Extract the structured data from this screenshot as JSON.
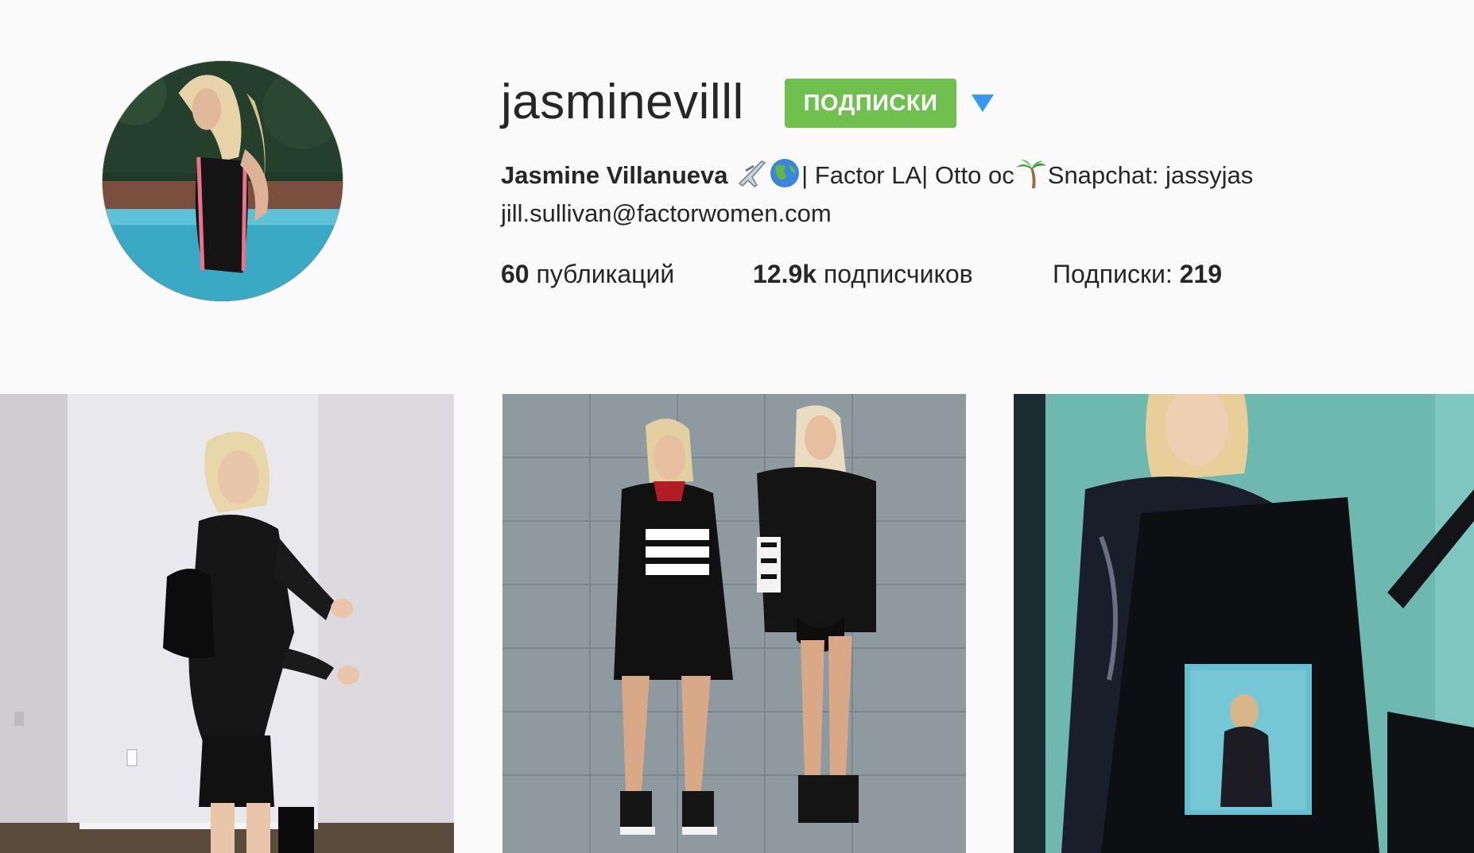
{
  "profile": {
    "username": "jasminevilll",
    "follow_button_label": "ПОДПИСКИ",
    "full_name": "Jasmine Villanueva",
    "bio_segment_1": "| Factor LA| Otto oc",
    "bio_segment_2": "Snapchat: jassyjas",
    "link": "jill.sullivan@factorwomen.com"
  },
  "stats": {
    "posts_count": "60",
    "posts_label": " публикаций",
    "followers_count": "12.9k",
    "followers_label": " подписчиков",
    "following_label": "Подписки: ",
    "following_count": "219"
  },
  "icons": {
    "dropdown": "caret-down-icon",
    "bio_emoji_1": "airplane-emoji",
    "bio_emoji_2": "globe-emoji",
    "bio_emoji_3": "palm-tree-emoji"
  },
  "colors": {
    "follow_button": "#70c050",
    "dropdown_caret": "#3897f0",
    "background": "#fafafa"
  },
  "posts": [
    {
      "alt_name": "post-photo-leather-jacket"
    },
    {
      "alt_name": "post-photo-two-models-adidas"
    },
    {
      "alt_name": "post-photo-camera-screen"
    }
  ]
}
